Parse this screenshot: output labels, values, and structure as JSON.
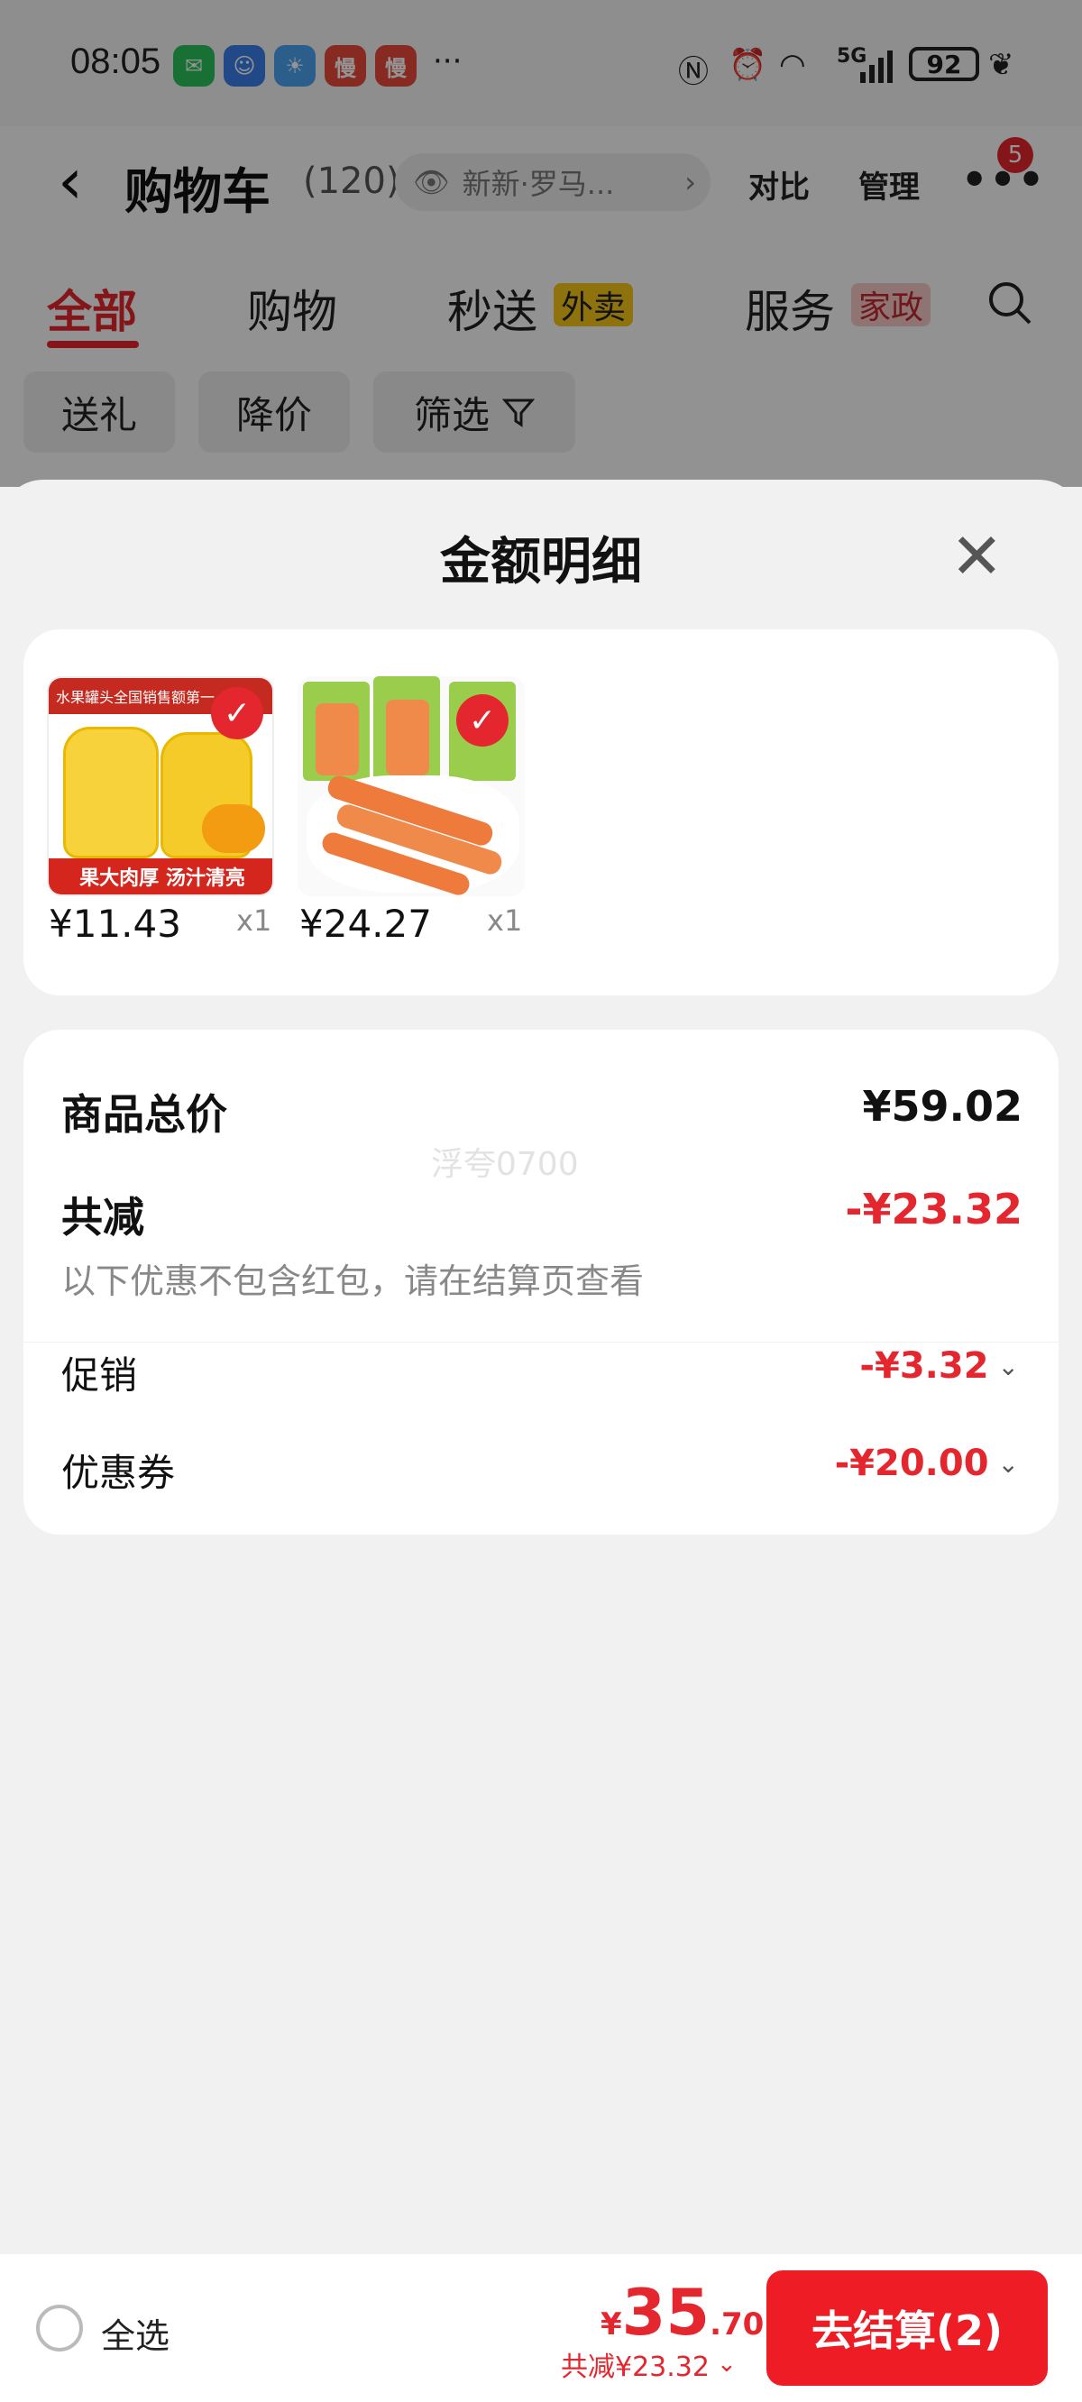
{
  "status_bar": {
    "time": "08:05",
    "more": "···",
    "network": "5G",
    "battery": "92"
  },
  "header": {
    "back_icon": "chevron-left-icon",
    "title": "购物车",
    "count": "(120)",
    "address": "新新·罗马...",
    "compare": "对比",
    "manage": "管理",
    "more_badge": "5"
  },
  "tabs": [
    {
      "label": "全部"
    },
    {
      "label": "购物"
    },
    {
      "label": "秒送",
      "tag": "外卖"
    },
    {
      "label": "服务",
      "tag": "家政"
    }
  ],
  "filters": [
    "送礼",
    "降价",
    "筛选"
  ],
  "sheet": {
    "title": "金额明细",
    "products": [
      {
        "name": "水果罐头",
        "banner_top": "水果罐头全国销售额第一",
        "banner_bottom": "果大肉厚 汤汁清亮",
        "price": "¥11.43",
        "qty": "x1"
      },
      {
        "name": "蟹棒",
        "price": "¥24.27",
        "qty": "x1"
      }
    ],
    "watermark": "浮夸0700",
    "total_label": "商品总价",
    "total_value": "¥59.02",
    "reduce_label": "共减",
    "reduce_value": "-¥23.32",
    "reduce_note": "以下优惠不包含红包，请在结算页查看",
    "promo_label": "促销",
    "promo_value": "-¥3.32",
    "coupon_label": "优惠券",
    "coupon_value": "-¥20.00"
  },
  "bottom_bar": {
    "select_all": "全选",
    "currency": "¥",
    "price_int": "35",
    "price_dec": ".70",
    "saved": "共减¥23.32",
    "checkout": "去结算(2)"
  },
  "colors": {
    "accent": "#e4262e",
    "checkout": "#ee1c25",
    "background": "#f1f1f2"
  }
}
